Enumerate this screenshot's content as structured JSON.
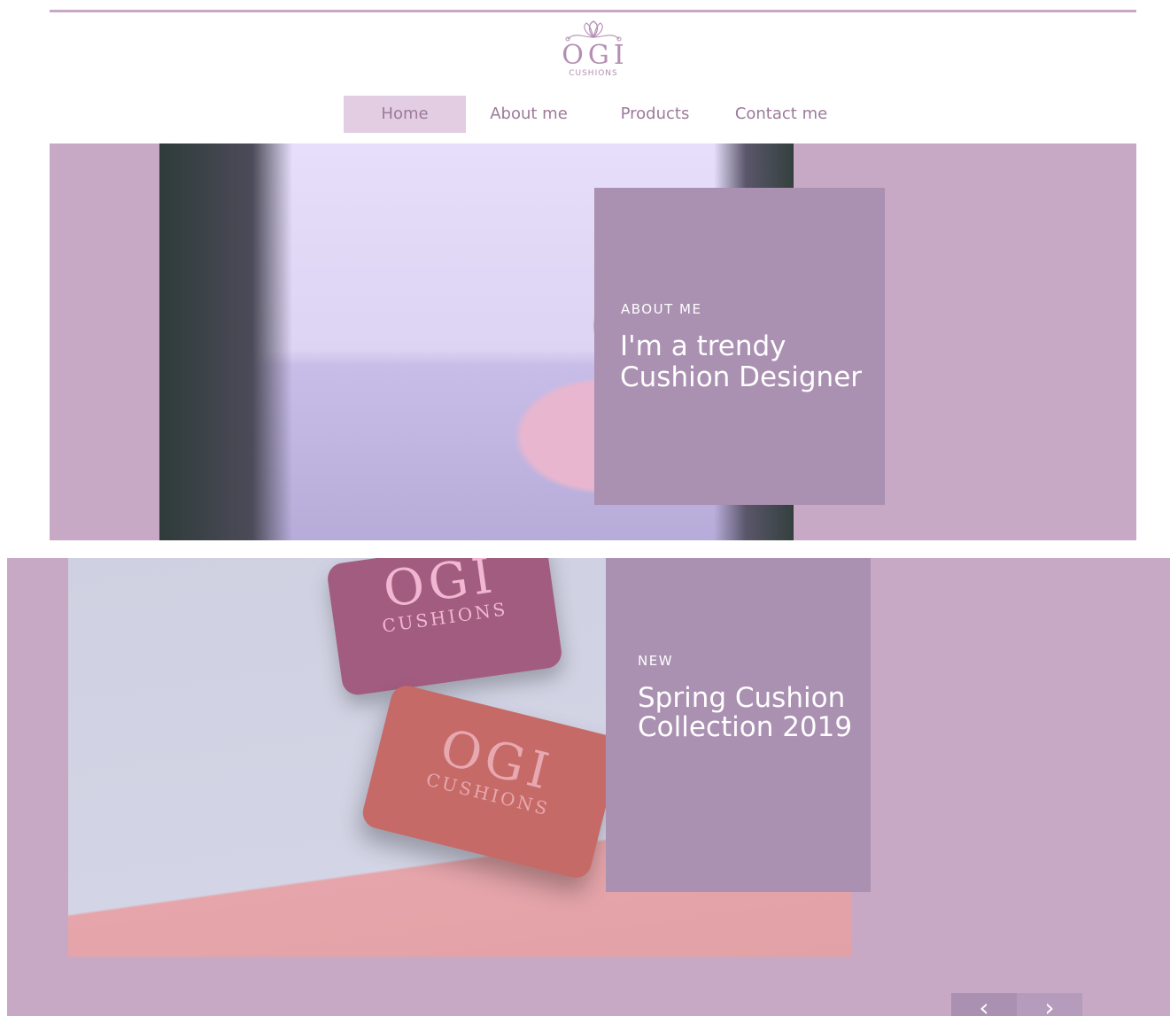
{
  "brand": {
    "name": "OGI",
    "tagline": "CUSHIONS"
  },
  "nav": {
    "items": [
      {
        "label": "Home",
        "active": true
      },
      {
        "label": "About me",
        "active": false
      },
      {
        "label": "Products",
        "active": false
      },
      {
        "label": "Contact me",
        "active": false
      }
    ]
  },
  "slides": [
    {
      "eyebrow": "ABOUT ME",
      "headline_line1": "I'm a trendy",
      "headline_line2": "Cushion Designer"
    },
    {
      "eyebrow": "NEW",
      "headline_line1": "Spring Cushion",
      "headline_line2": "Collection 2019",
      "product_brand": "OGI",
      "product_tagline": "CUSHIONS"
    }
  ],
  "slider": {
    "prev_icon": "chevron-left-icon",
    "next_icon": "chevron-right-icon",
    "prev_glyph": "‹",
    "next_glyph": "›"
  },
  "colors": {
    "accent": "#c7a9c6",
    "card": "#aa90b1",
    "nav_active": "#e3cde2",
    "nav_text": "#9c7a9b"
  }
}
